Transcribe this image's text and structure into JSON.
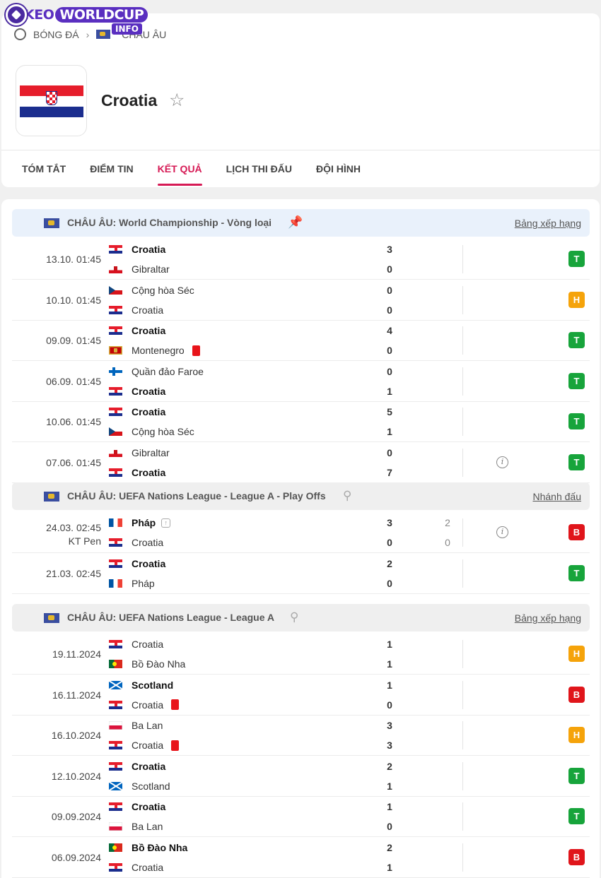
{
  "logo": {
    "part1": "KEO",
    "part2": "WORLDCUP",
    "suffix": "INFO"
  },
  "breadcrumb": {
    "sport": "BÓNG ĐÁ",
    "region": "CHÂU ÂU"
  },
  "team": {
    "name": "Croatia"
  },
  "tabs": [
    "TÓM TẮT",
    "ĐIỂM TIN",
    "KẾT QUẢ",
    "LỊCH THI ĐẤU",
    "ĐỘI HÌNH"
  ],
  "active_tab": "KẾT QUẢ",
  "colors": {
    "accent": "#d61a55",
    "win": "#17a43b",
    "draw": "#f5a30a",
    "loss": "#e0151b"
  },
  "competitions": [
    {
      "name": "CHÂU ÂU: World Championship - Vòng loại",
      "pinned": true,
      "link": "Bảng xếp hạng",
      "matches": [
        {
          "date": "13.10. 01:45",
          "home": {
            "name": "Croatia",
            "flag": "hr",
            "score": "3",
            "bold": true
          },
          "away": {
            "name": "Gibraltar",
            "flag": "gi",
            "score": "0",
            "bold": false
          },
          "result": "T"
        },
        {
          "date": "10.10. 01:45",
          "home": {
            "name": "Cộng hòa Séc",
            "flag": "cz",
            "score": "0",
            "bold": false
          },
          "away": {
            "name": "Croatia",
            "flag": "hr",
            "score": "0",
            "bold": false
          },
          "result": "H"
        },
        {
          "date": "09.09. 01:45",
          "home": {
            "name": "Croatia",
            "flag": "hr",
            "score": "4",
            "bold": true
          },
          "away": {
            "name": "Montenegro",
            "flag": "me",
            "score": "0",
            "bold": false,
            "red_card": true
          },
          "result": "T"
        },
        {
          "date": "06.09. 01:45",
          "home": {
            "name": "Quần đảo Faroe",
            "flag": "fo",
            "score": "0",
            "bold": false
          },
          "away": {
            "name": "Croatia",
            "flag": "hr",
            "score": "1",
            "bold": true
          },
          "result": "T"
        },
        {
          "date": "10.06. 01:45",
          "home": {
            "name": "Croatia",
            "flag": "hr",
            "score": "5",
            "bold": true
          },
          "away": {
            "name": "Cộng hòa Séc",
            "flag": "cz",
            "score": "1",
            "bold": false
          },
          "result": "T"
        },
        {
          "date": "07.06. 01:45",
          "home": {
            "name": "Gibraltar",
            "flag": "gi",
            "score": "0",
            "bold": false
          },
          "away": {
            "name": "Croatia",
            "flag": "hr",
            "score": "7",
            "bold": true
          },
          "result": "T",
          "info": true
        }
      ]
    },
    {
      "name": "CHÂU ÂU: UEFA Nations League - League A - Play Offs",
      "pinned": false,
      "link": "Nhánh đấu",
      "matches": [
        {
          "date": "24.03. 02:45",
          "note": "KT Pen",
          "home": {
            "name": "Pháp",
            "flag": "fr",
            "score": "3",
            "score2": "2",
            "bold": true,
            "advance": true
          },
          "away": {
            "name": "Croatia",
            "flag": "hr",
            "score": "0",
            "score2": "0",
            "bold": false
          },
          "result": "B",
          "info": true
        },
        {
          "date": "21.03. 02:45",
          "home": {
            "name": "Croatia",
            "flag": "hr",
            "score": "2",
            "bold": true
          },
          "away": {
            "name": "Pháp",
            "flag": "fr",
            "score": "0",
            "bold": false
          },
          "result": "T"
        }
      ]
    },
    {
      "name": "CHÂU ÂU: UEFA Nations League - League A",
      "pinned": false,
      "link": "Bảng xếp hạng",
      "matches": [
        {
          "date": "19.11.2024",
          "home": {
            "name": "Croatia",
            "flag": "hr",
            "score": "1",
            "bold": false
          },
          "away": {
            "name": "Bồ Đào Nha",
            "flag": "pt",
            "score": "1",
            "bold": false
          },
          "result": "H"
        },
        {
          "date": "16.11.2024",
          "home": {
            "name": "Scotland",
            "flag": "sc",
            "score": "1",
            "bold": true
          },
          "away": {
            "name": "Croatia",
            "flag": "hr",
            "score": "0",
            "bold": false,
            "red_card": true
          },
          "result": "B"
        },
        {
          "date": "16.10.2024",
          "home": {
            "name": "Ba Lan",
            "flag": "pl",
            "score": "3",
            "bold": false
          },
          "away": {
            "name": "Croatia",
            "flag": "hr",
            "score": "3",
            "bold": false,
            "red_card": true
          },
          "result": "H"
        },
        {
          "date": "12.10.2024",
          "home": {
            "name": "Croatia",
            "flag": "hr",
            "score": "2",
            "bold": true
          },
          "away": {
            "name": "Scotland",
            "flag": "sc",
            "score": "1",
            "bold": false
          },
          "result": "T"
        },
        {
          "date": "09.09.2024",
          "home": {
            "name": "Croatia",
            "flag": "hr",
            "score": "1",
            "bold": true
          },
          "away": {
            "name": "Ba Lan",
            "flag": "pl",
            "score": "0",
            "bold": false
          },
          "result": "T"
        },
        {
          "date": "06.09.2024",
          "home": {
            "name": "Bồ Đào Nha",
            "flag": "pt",
            "score": "2",
            "bold": true
          },
          "away": {
            "name": "Croatia",
            "flag": "hr",
            "score": "1",
            "bold": false
          },
          "result": "B"
        }
      ]
    }
  ]
}
